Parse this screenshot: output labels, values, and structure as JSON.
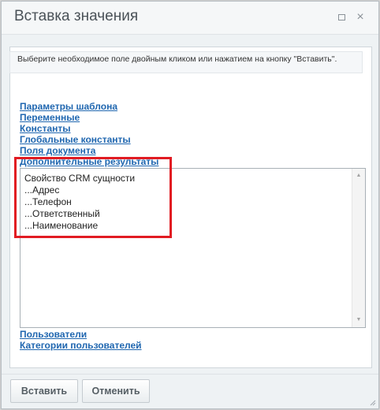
{
  "dialog": {
    "title": "Вставка значения",
    "maximize_glyph": "",
    "close_glyph": "×",
    "info_text": "Выберите необходимое поле двойным кликом или нажатием на кнопку \"Вставить\".",
    "sections_top": [
      "Параметры шаблона",
      "Переменные",
      "Константы",
      "Глобальные константы",
      "Поля документа",
      "Дополнительные результаты"
    ],
    "list_items": [
      "Свойство CRM сущности",
      "...Адрес",
      "...Телефон",
      "...Ответственный",
      "...Наименование"
    ],
    "sections_bottom": [
      "Пользователи",
      "Категории пользователей"
    ],
    "buttons": {
      "insert": "Вставить",
      "cancel": "Отменить"
    },
    "icons": {
      "maximize": "maximize-icon",
      "close": "close-icon",
      "scroll_up": "scroll-up-icon",
      "scroll_down": "scroll-down-icon",
      "resize": "resize-grip-icon"
    },
    "colors": {
      "link": "#2067b0",
      "highlight": "#e11b22"
    }
  }
}
